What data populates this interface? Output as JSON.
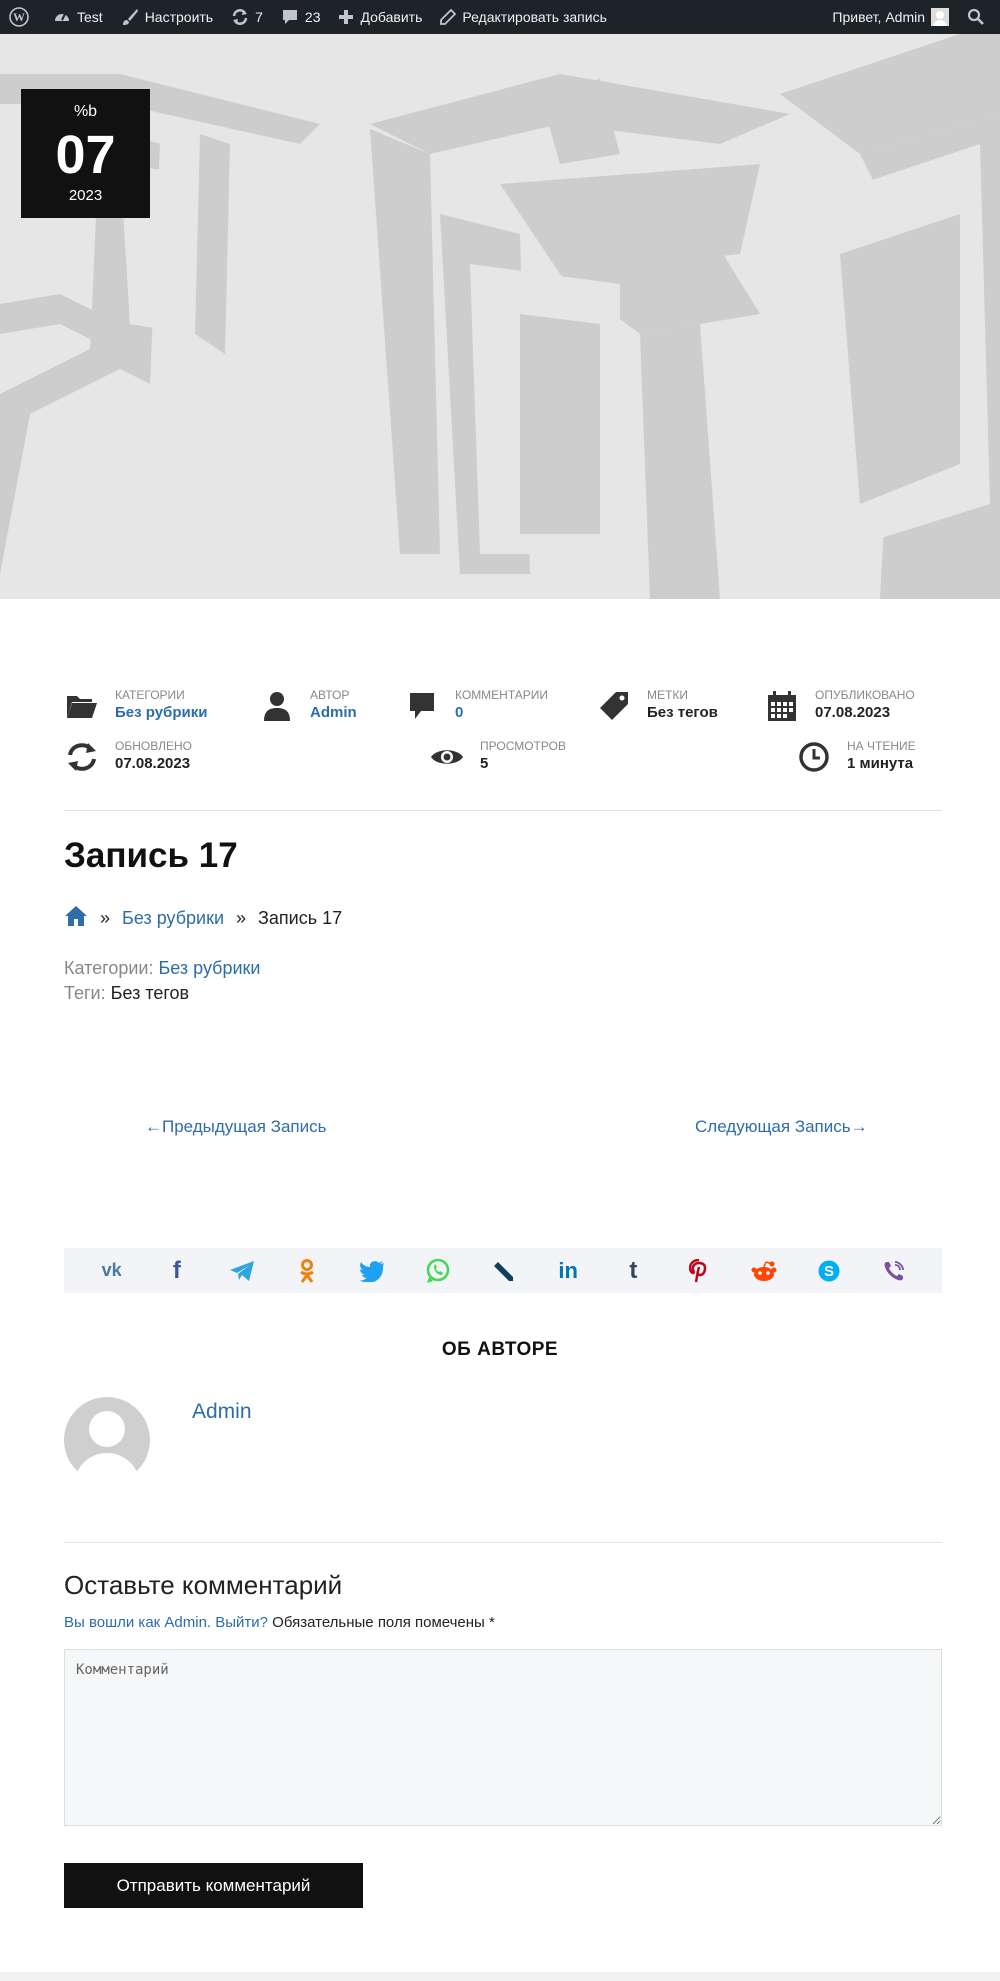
{
  "adminbar": {
    "site": "Test",
    "customize": "Настроить",
    "updates": "7",
    "comments": "23",
    "add_new": "Добавить",
    "edit_post": "Редактировать запись",
    "greeting": "Привет, Admin"
  },
  "date_badge": {
    "month": "%b",
    "day": "07",
    "year": "2023"
  },
  "meta": {
    "categories": {
      "label": "Категории",
      "value": "Без рубрики"
    },
    "author": {
      "label": "Автор",
      "value": "Admin"
    },
    "comments": {
      "label": "Комментарии",
      "value": "0"
    },
    "tags": {
      "label": "Метки",
      "value": "Без тегов"
    },
    "published": {
      "label": "Опубликовано",
      "value": "07.08.2023"
    },
    "updated": {
      "label": "Обновлено",
      "value": "07.08.2023"
    },
    "views": {
      "label": "Просмотров",
      "value": "5"
    },
    "reading": {
      "label": "На чтение",
      "value": "1 минута"
    }
  },
  "post": {
    "title": "Запись 17",
    "breadcrumb_sep": "»",
    "breadcrumb_category": "Без рубрики",
    "breadcrumb_current": "Запись 17",
    "categories_label": "Категории:",
    "categories_value": "Без рубрики",
    "tags_label": "Теги:",
    "tags_value": "Без тегов"
  },
  "nav": {
    "prev": "←Предыдущая Запись",
    "next": "Следующая Запись→"
  },
  "share_icons": [
    "vk-icon",
    "facebook-icon",
    "telegram-icon",
    "odnoklassniki-icon",
    "twitter-icon",
    "whatsapp-icon",
    "livejournal-icon",
    "linkedin-icon",
    "tumblr-icon",
    "pinterest-icon",
    "reddit-icon",
    "skype-icon",
    "viber-icon"
  ],
  "share_colors": {
    "vk": "#4a76a8",
    "facebook": "#3b5998",
    "telegram": "#2ca5e0",
    "ok": "#ee8208",
    "twitter": "#1da1f2",
    "whatsapp": "#43d854",
    "livejournal": "#0d425a",
    "linkedin": "#0077b5",
    "tumblr": "#35465c",
    "pinterest": "#bd081c",
    "reddit": "#ff4500",
    "skype": "#00aff0",
    "viber": "#7b519d"
  },
  "share_text": {
    "vk": "vk",
    "linkedin": "in",
    "tumblr": "t",
    "facebook": "f"
  },
  "about": {
    "heading": "ОБ АВТОРЕ",
    "name": "Admin"
  },
  "reply": {
    "heading": "Оставьте комментарий",
    "logged_in_prefix": "Вы вошли как Admin.",
    "logout": "Выйти?",
    "required_note": " Обязательные поля помечены *",
    "placeholder": "Комментарий",
    "submit": "Отправить комментарий"
  },
  "colors": {
    "adminbar_bg": "#1d2327",
    "link": "#2d6da8",
    "badge_bg": "#111111"
  }
}
